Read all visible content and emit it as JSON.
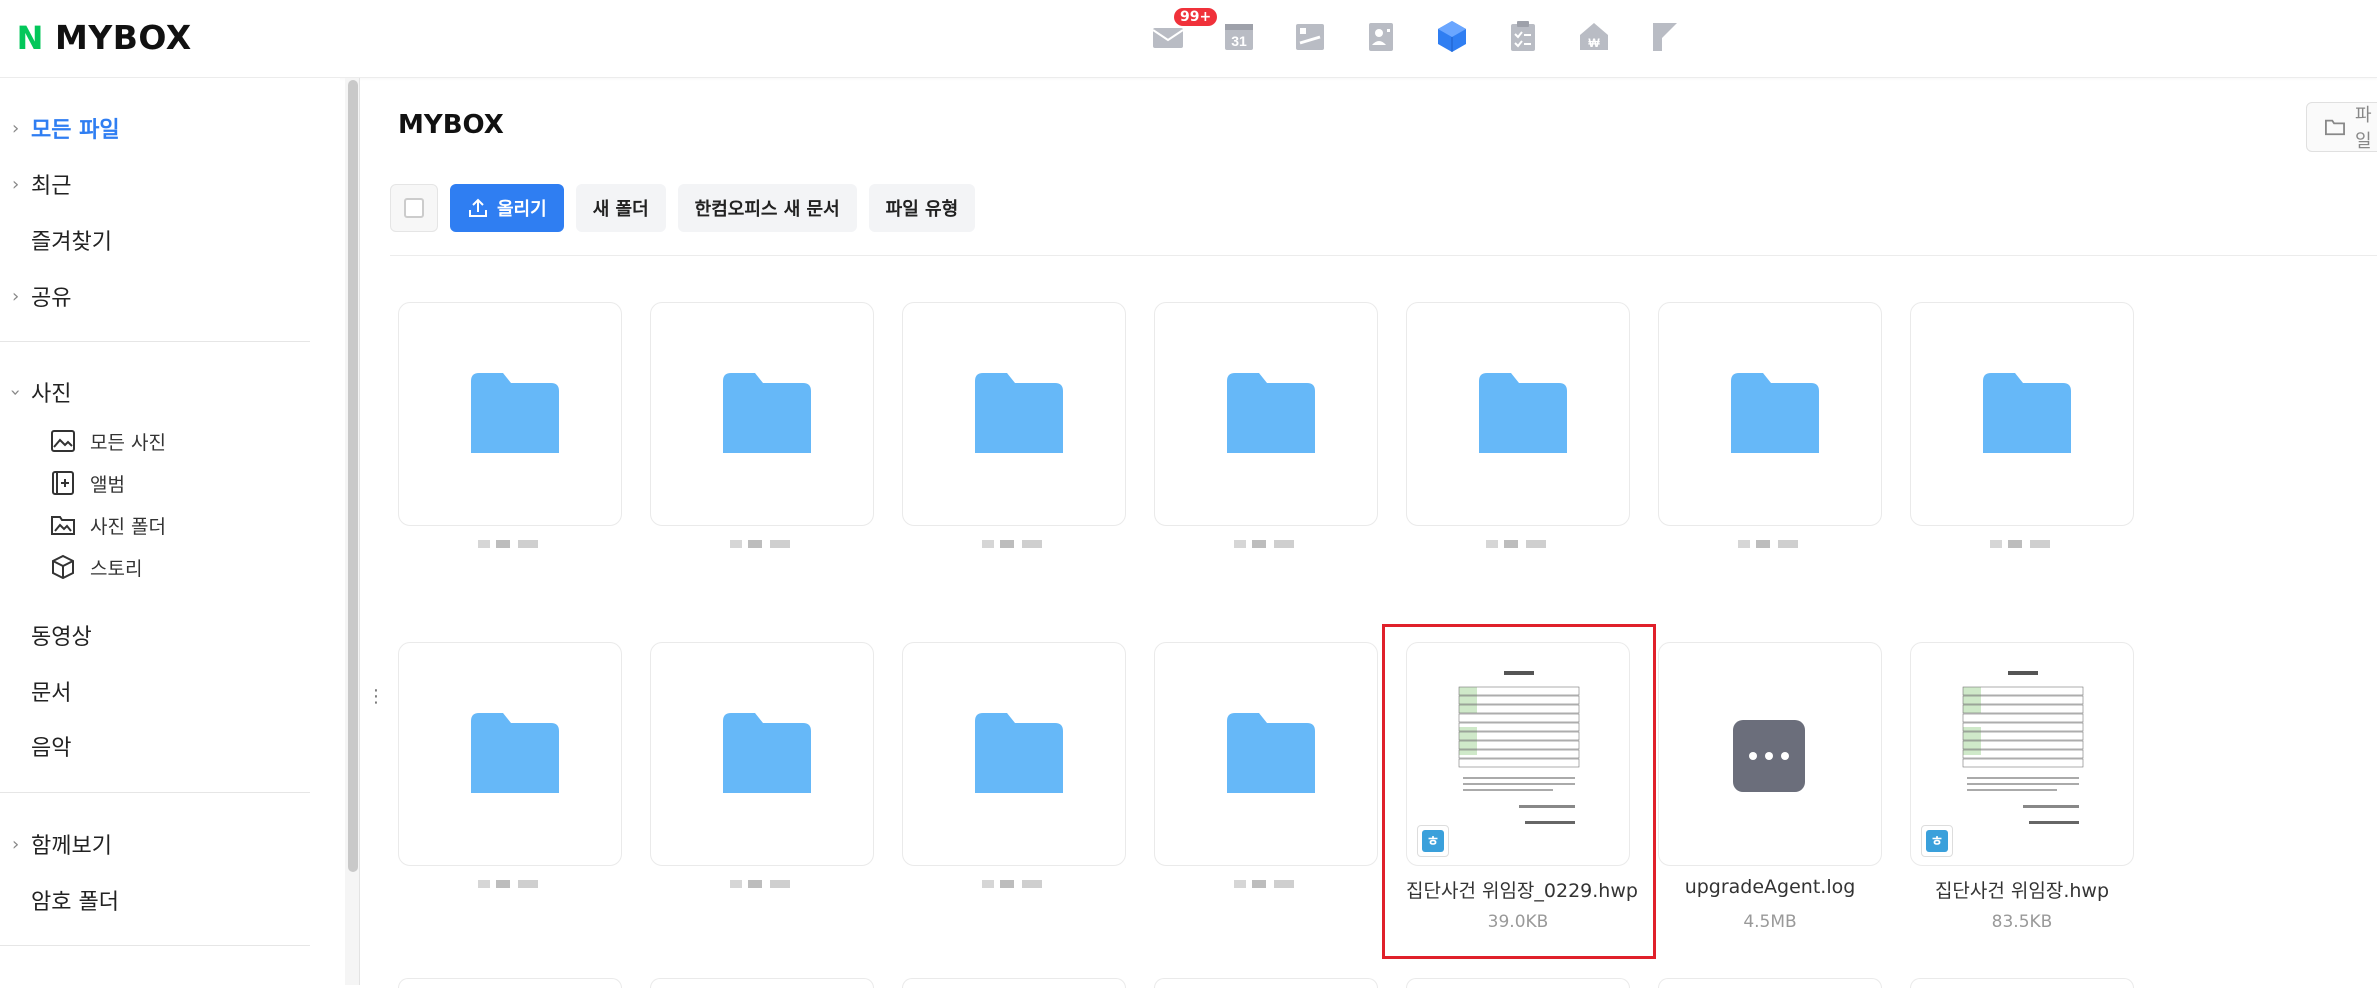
{
  "header": {
    "logo_letter": "N",
    "logo_text": "MYBOX",
    "mail_badge": "99+",
    "calendar_day": "31"
  },
  "sidebar": {
    "all_files": "모든 파일",
    "recent": "최근",
    "favorites": "즐겨찾기",
    "shared": "공유",
    "photos": "사진",
    "photo_subitems": [
      "모든 사진",
      "앨범",
      "사진 폴더",
      "스토리"
    ],
    "videos": "동영상",
    "documents": "문서",
    "music": "음악",
    "watch_together": "함께보기",
    "secret_folder": "암호 폴더"
  },
  "main": {
    "title": "MYBOX",
    "top_right_label": "파일",
    "toolbar": {
      "upload": "올리기",
      "new_folder": "새 폴더",
      "hancom_new_doc": "한컴오피스 새 문서",
      "file_type": "파일 유형"
    },
    "files": [
      {
        "name": "집단사건 위임장_0229.hwp",
        "size": "39.0KB"
      },
      {
        "name": "upgradeAgent.log",
        "size": "4.5MB"
      },
      {
        "name": "집단사건 위임장.hwp",
        "size": "83.5KB"
      }
    ]
  },
  "colors": {
    "accent": "#2f7ef2",
    "folder": "#66b8f8",
    "highlight": "#e0202a",
    "naver_green": "#03c75a"
  }
}
